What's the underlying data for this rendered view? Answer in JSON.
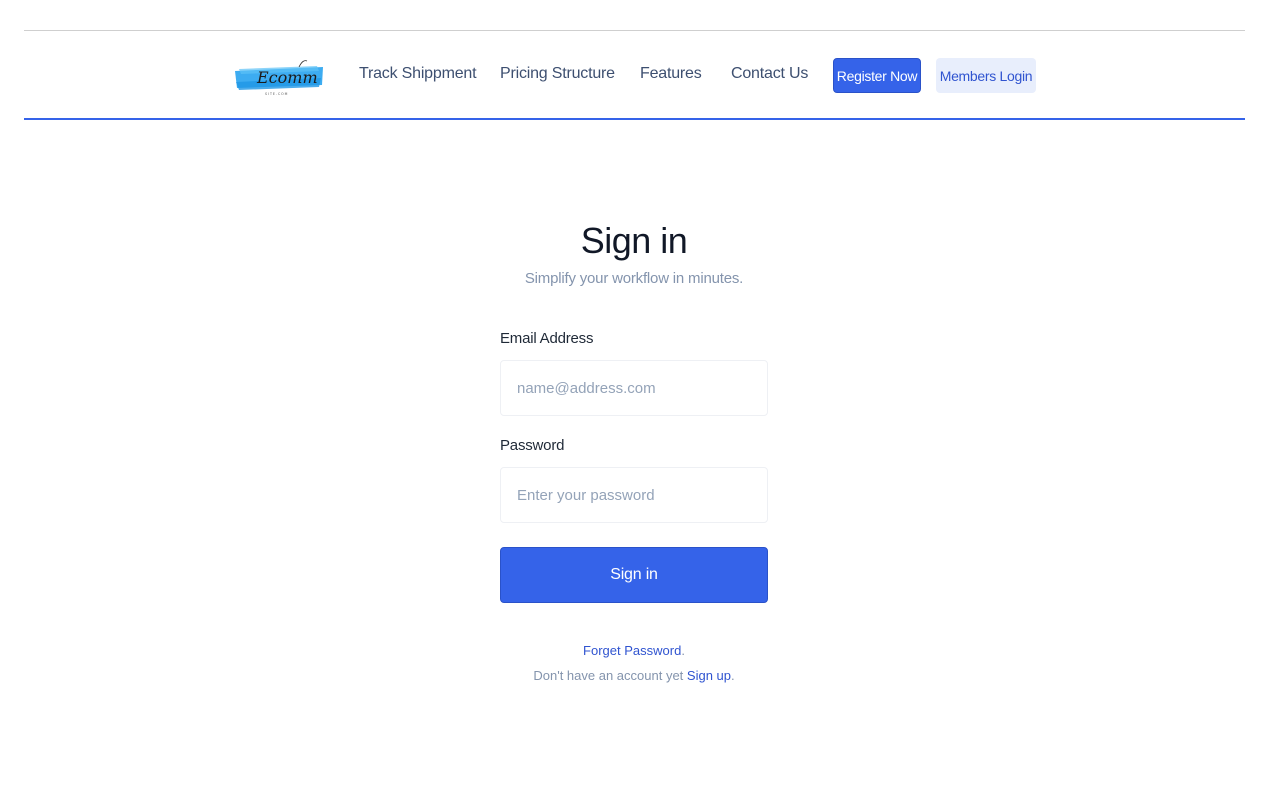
{
  "brand": {
    "logo_text": "Ecomm",
    "logo_tagline": "SITE.COM",
    "logo_color": "#33a8f0"
  },
  "nav": {
    "links": [
      {
        "label": "Track Shippment"
      },
      {
        "label": "Pricing Structure"
      },
      {
        "label": "Features"
      },
      {
        "label": "Contact Us"
      }
    ],
    "register_label": "Register Now",
    "members_label": "Members Login"
  },
  "signin": {
    "title": "Sign in",
    "subtitle": "Simplify your workflow in minutes.",
    "email_label": "Email Address",
    "email_placeholder": "name@address.com",
    "email_value": "",
    "password_label": "Password",
    "password_placeholder": "Enter your password",
    "password_value": "",
    "submit_label": "Sign in",
    "forget_link": "Forget Password",
    "forget_suffix": ".",
    "no_account_text": "Don't have an account yet ",
    "signup_link": "Sign up",
    "signup_suffix": "."
  },
  "colors": {
    "primary": "#3563e9",
    "primary_light": "#e8eefc",
    "muted_text": "#8494ad",
    "nav_text": "#3d4f70"
  }
}
